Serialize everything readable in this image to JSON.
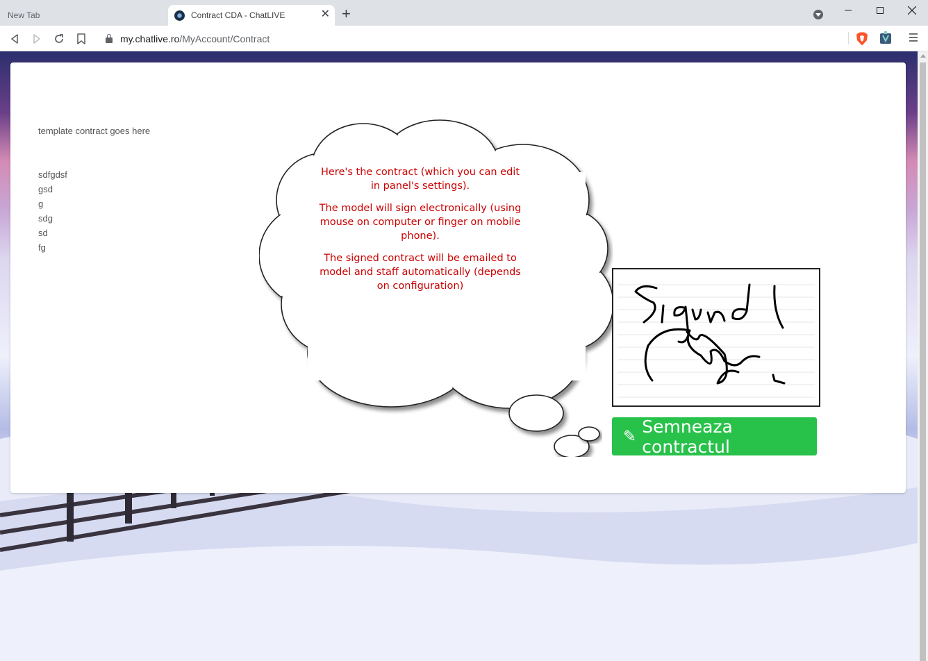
{
  "browser": {
    "tabs": [
      {
        "title": "New Tab",
        "active": false
      },
      {
        "title": "Contract CDA - ChatLIVE",
        "active": true
      }
    ],
    "url_host": "my.chatlive.ro",
    "url_path": "/MyAccount/Contract"
  },
  "contract": {
    "lead": "template contract goes here",
    "lines": [
      "sdfgdsf",
      "gsd",
      "g",
      "sdg",
      "sd",
      "fg"
    ]
  },
  "tooltip": {
    "paragraph1": "Here's the contract (which you can edit in panel's settings).",
    "paragraph2": "The model will sign electronically (using mouse on computer or finger on mobile phone).",
    "paragraph3": "The signed contract will be emailed to model and staff automatically (depends on configuration)",
    "color": "#cc0000"
  },
  "signature": {
    "text": "Signed"
  },
  "sign_button": {
    "label": "Semneaza contractul",
    "icon": "pencil-icon",
    "color": "#28c14a"
  }
}
